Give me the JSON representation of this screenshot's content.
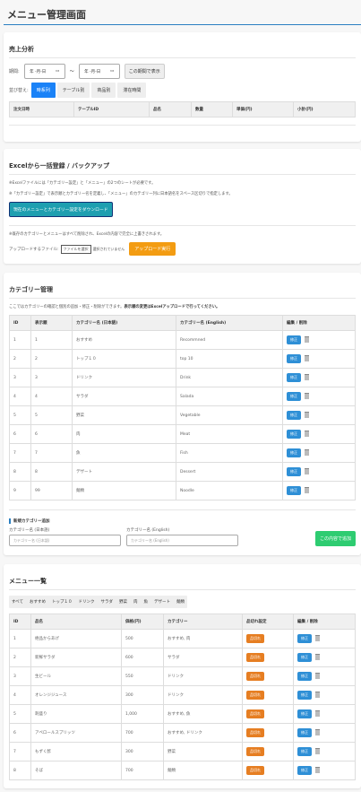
{
  "title": "メニュー管理画面",
  "sales": {
    "heading": "売上分析",
    "period_label": "期間:",
    "date_from": "年 -月-日",
    "date_to": "年 -月-日",
    "tilde": "〜",
    "show_btn": "この期間で表示",
    "sort_label": "並び替え:",
    "sort_options": [
      "時系列",
      "テーブル別",
      "商品別",
      "滞在時間"
    ],
    "columns": [
      "注文日時",
      "テーブルID",
      "品名",
      "数量",
      "単価(円)",
      "小計(円)"
    ]
  },
  "excel": {
    "heading": "Excelから一括登録 / バックアップ",
    "note1": "※Excelファイルには「カテゴリー設定」と「メニュー」の2つのシートが必要です。",
    "note2": "※「カテゴリー設定」で表示順とカテゴリー名を定義し、「メニュー」のカテゴリー列に日本語名をスペース区切りで指定します。",
    "download_btn": "現在のメニューとカテゴリー設定をダウンロード",
    "warning": "※既存のカテゴリーとメニューはすべて削除され、Excelの内容で完全に上書きされます。",
    "file_label": "アップロードするファイル:",
    "file_btn": "ファイルを選択",
    "file_status": "選択されていません",
    "upload_btn": "アップロード実行"
  },
  "categories": {
    "heading": "カテゴリー管理",
    "desc": "ここではカテゴリーの確認と個別の追加・修正・削除ができます。",
    "desc_bold": "表示順の変更はExcelアップロードで行ってください。",
    "columns": [
      "ID",
      "表示順",
      "カテゴリー名 (日本語)",
      "カテゴリー名 (English)",
      "編集 / 削除"
    ],
    "edit_label": "修正",
    "rows": [
      [
        "1",
        "1",
        "おすすめ",
        "Recommned"
      ],
      [
        "2",
        "2",
        "トップ１０",
        "top 10"
      ],
      [
        "3",
        "3",
        "ドリンク",
        "Drink"
      ],
      [
        "4",
        "4",
        "サラダ",
        "Salada"
      ],
      [
        "5",
        "5",
        "野菜",
        "Vegetable"
      ],
      [
        "6",
        "6",
        "肉",
        "Meat"
      ],
      [
        "7",
        "7",
        "魚",
        "Fish"
      ],
      [
        "8",
        "8",
        "デザート",
        "Dessert"
      ],
      [
        "9",
        "99",
        "麺類",
        "Noodle"
      ]
    ],
    "add_heading": "新規カテゴリー追加",
    "ja_label": "カテゴリー名 (日本語)",
    "ja_placeholder": "カテゴリー名 (日本語)",
    "en_label": "カテゴリー名 (English)",
    "en_placeholder": "カテゴリー名 (English)",
    "add_btn": "この内容で追加"
  },
  "menu": {
    "heading": "メニュー一覧",
    "filters": [
      "すべて",
      "おすすめ",
      "トップ１０",
      "ドリンク",
      "サラダ",
      "野菜",
      "肉",
      "魚",
      "デザート",
      "麺類"
    ],
    "columns": [
      "ID",
      "品名",
      "価格(円)",
      "カテゴリー",
      "品切れ設定",
      "編集 / 削除"
    ],
    "sold_label": "品切れ",
    "edit_label": "修正",
    "rows": [
      [
        "1",
        "絶品からあげ",
        "500",
        "おすすめ, 肉"
      ],
      [
        "2",
        "新鮮サラダ",
        "600",
        "サラダ"
      ],
      [
        "3",
        "生ビール",
        "550",
        "ドリンク"
      ],
      [
        "4",
        "オレンジジュース",
        "300",
        "ドリンク"
      ],
      [
        "5",
        "刺盛り",
        "1,000",
        "おすすめ, 魚"
      ],
      [
        "6",
        "アペロールスプリッツ",
        "700",
        "おすすめ, ドリンク"
      ],
      [
        "7",
        "もずく酢",
        "300",
        "野菜"
      ],
      [
        "8",
        "そば",
        "700",
        "麺類"
      ]
    ]
  }
}
